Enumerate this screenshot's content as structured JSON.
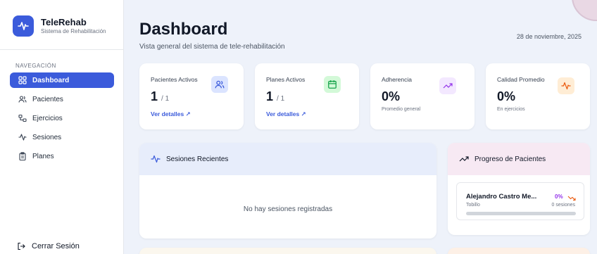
{
  "app": {
    "title": "TeleRehab",
    "subtitle": "Sistema de Rehabilitación"
  },
  "sidebar": {
    "section_title": "NAVEGACIÓN",
    "items": [
      {
        "label": "Dashboard",
        "icon": "dashboard-grid-icon",
        "active": true
      },
      {
        "label": "Pacientes",
        "icon": "users-icon",
        "active": false
      },
      {
        "label": "Ejercicios",
        "icon": "exercises-icon",
        "active": false
      },
      {
        "label": "Sesiones",
        "icon": "activity-icon",
        "active": false
      },
      {
        "label": "Planes",
        "icon": "clipboard-icon",
        "active": false
      }
    ],
    "logout_label": "Cerrar Sesión"
  },
  "header": {
    "title": "Dashboard",
    "subtitle": "Vista general del sistema de tele-rehabilitación",
    "date": "28 de noviembre, 2025"
  },
  "stats": [
    {
      "label": "Pacientes Activos",
      "value": "1",
      "total": "/ 1",
      "link": "Ver detalles ↗",
      "icon": "users-icon",
      "icon_bg": "#dbe4ff",
      "icon_color": "#3b5bdb"
    },
    {
      "label": "Planes Activos",
      "value": "1",
      "total": "/ 1",
      "link": "Ver detalles ↗",
      "icon": "calendar-icon",
      "icon_bg": "#d3f9d8",
      "icon_color": "#16a34a"
    },
    {
      "label": "Adherencia",
      "value": "0%",
      "note": "Promedio general",
      "icon": "trending-up-icon",
      "icon_bg": "#f3e8ff",
      "icon_color": "#9333ea"
    },
    {
      "label": "Calidad Promedio",
      "value": "0%",
      "note": "En ejercicios",
      "icon": "activity-icon",
      "icon_bg": "#ffedd5",
      "icon_color": "#ea580c"
    }
  ],
  "recent_sessions": {
    "title": "Sesiones Recientes",
    "empty_text": "No hay sesiones registradas"
  },
  "patient_progress": {
    "title": "Progreso de Pacientes",
    "patients": [
      {
        "name": "Alejandro Castro Me...",
        "condition": "Tobillo",
        "percent_label": "0%",
        "progress": 0,
        "sessions": "0 sesiones"
      }
    ]
  },
  "colors": {
    "accent": "#3b5bdb",
    "background": "#eef2fa",
    "purple": "#9333ea",
    "orange": "#ea580c"
  }
}
